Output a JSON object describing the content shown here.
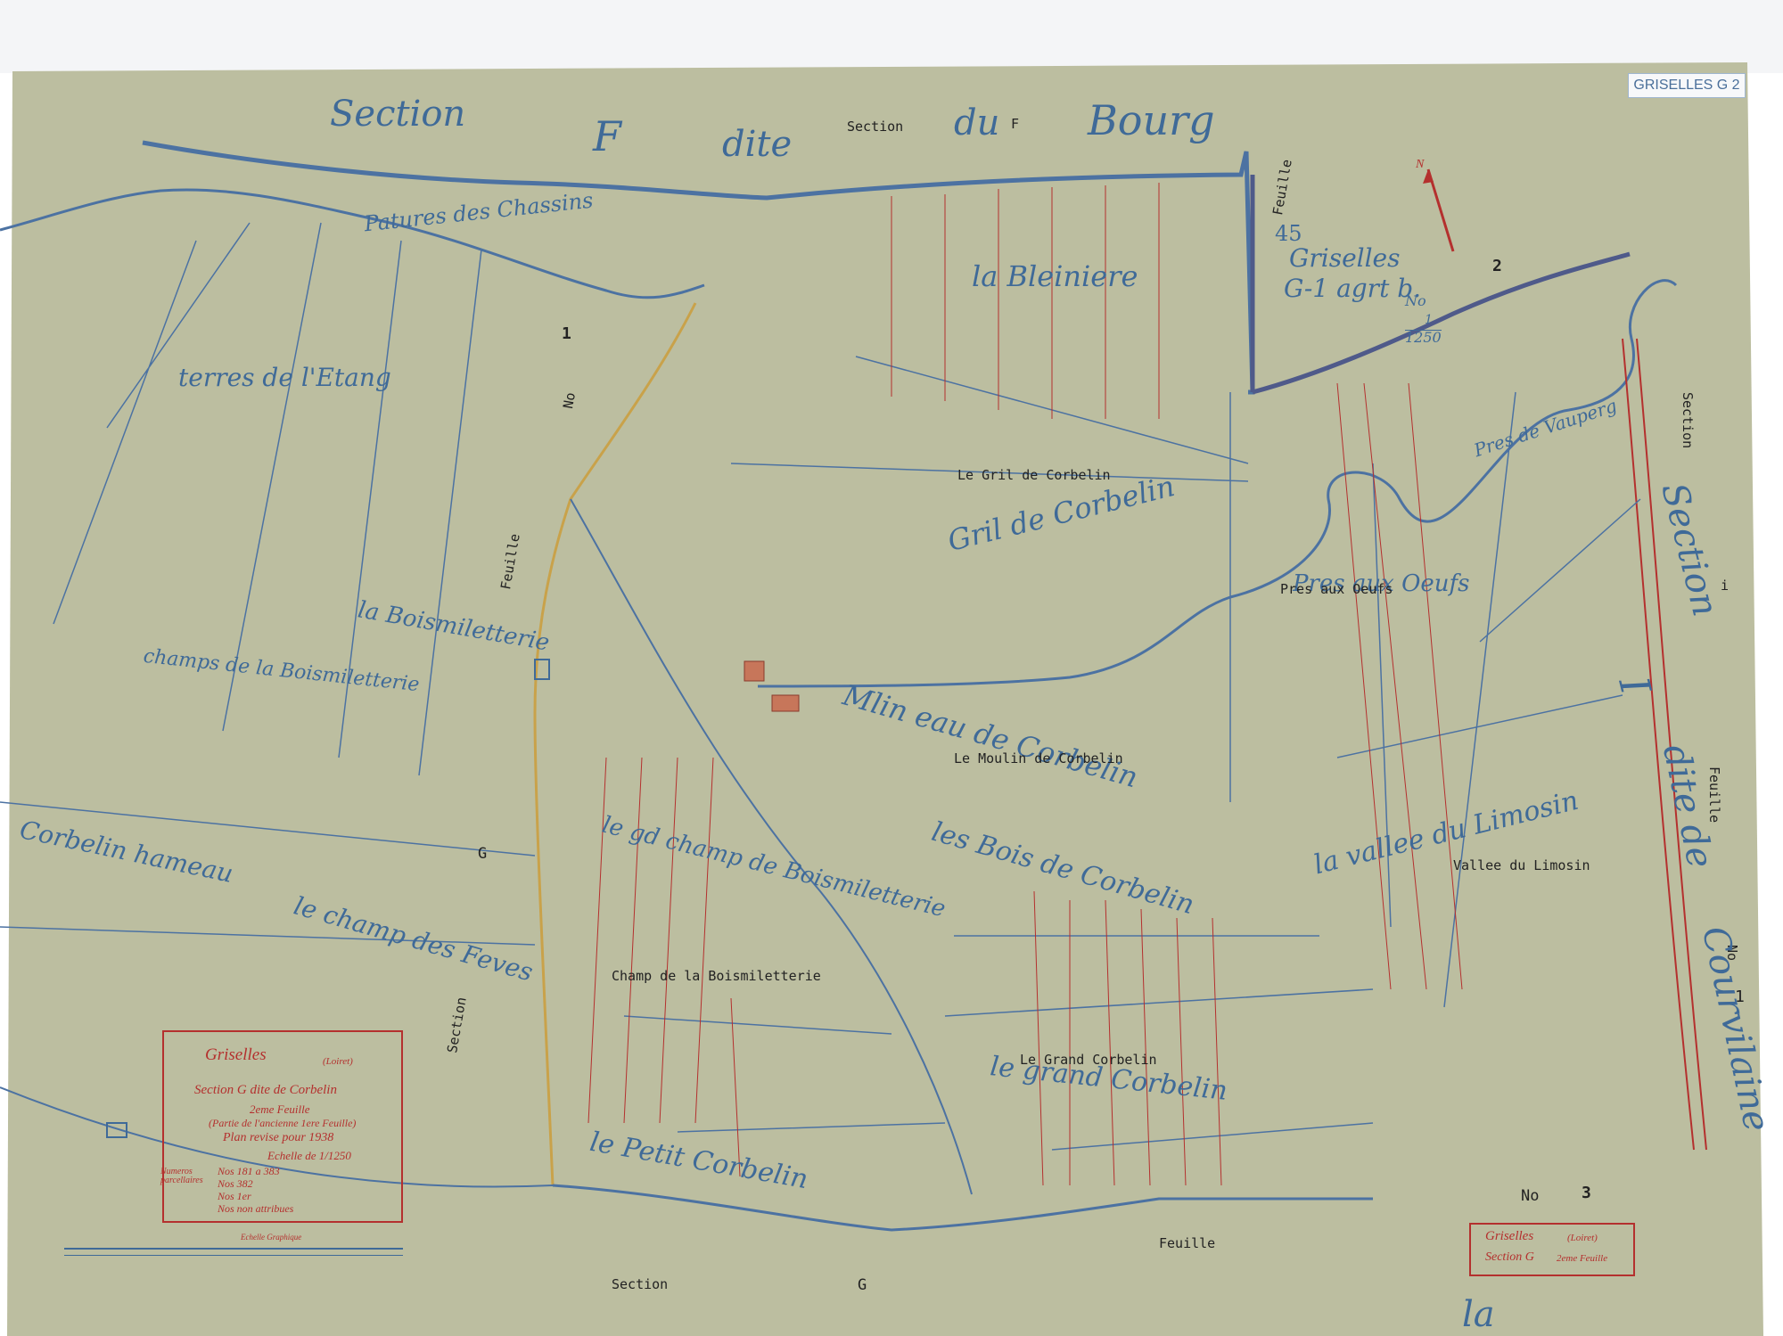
{
  "corner_tag": "GRISELLES G 2",
  "north": {
    "letter": "N",
    "sheet_no": "2"
  },
  "edge_labels": {
    "top_section": "Section",
    "top_letter": "F",
    "top_dite": "dite",
    "top_section_small": "Section",
    "top_du": "du",
    "top_f_small": "F",
    "top_bourg": "Bourg",
    "right_section": "Section",
    "right_letter": "I",
    "right_dite": "dite de",
    "right_name": "Courvilaine",
    "right_section_small": "Section",
    "right_i_small": "i",
    "right_feuille": "Feuille",
    "right_no": "No",
    "right_no_val": "1",
    "bottom_section": "Section",
    "bottom_g": "G",
    "bottom_feuille": "Feuille",
    "bottom_la": "la",
    "left_feuille": "Feuille",
    "left_section": "Section",
    "left_g": "G",
    "top_feuille": "Feuille",
    "no1": "No",
    "no1_val": "1",
    "no3": "No",
    "no3_val": "3"
  },
  "adjacent_sheet": {
    "num": "45",
    "place": "Griselles",
    "ref": "G-1 agrt b.",
    "no": "No",
    "scale_num": "1",
    "scale_den": "1250"
  },
  "place_names_blue": [
    "Patures des Chassins",
    "la Bleiniere",
    "terres de l'Etang",
    "Gril de Corbelin",
    "la Boismiletterie",
    "champs de la Boismiletterie",
    "Mlin eau de Corbelin",
    "Pres aux Oeufs",
    "Pres de Vauperg",
    "la vallee du Limosin",
    "Corbelin hameau",
    "le champ des Feves",
    "les Bois de Corbelin",
    "le gd champ de Boismiletterie",
    "le grand Corbelin",
    "le Petit Corbelin"
  ],
  "place_names_ink": {
    "gril": "Le Gril de Corbelin",
    "moulin": "Le Moulin de Corbelin",
    "pres": "Pres aux Oeufs",
    "vallee": "Vallee du Limosin",
    "champ": "Champ de la Boismiletterie",
    "grand": "Le Grand Corbelin"
  },
  "cartouche": {
    "commune": "Griselles",
    "dept": "(Loiret)",
    "section_line": "Section G dite de Corbelin",
    "feuille_line": "2eme Feuille",
    "partie_line": "(Partie de l'ancienne 1ere Feuille)",
    "revise_line": "Plan revise pour 1938",
    "echelle_line": "Echelle de 1/1250",
    "numeros_label": "Numeros parcellaires",
    "numeros_1": "Nos 181 a 383",
    "numeros_2": "Nos 382",
    "numeros_3": "Nos 1er",
    "numeros_4": "Nos non attribues",
    "echelle_graphique": "Echelle Graphique"
  },
  "label_box": {
    "commune": "Griselles",
    "dept": "(Loiret)",
    "section": "Section G",
    "feuille": "2eme Feuille"
  },
  "colors": {
    "paper": "#bcbea0",
    "blue_ink": "#3f6a98",
    "red_ink": "#b4302e",
    "road_yellow": "#c9a24a"
  }
}
